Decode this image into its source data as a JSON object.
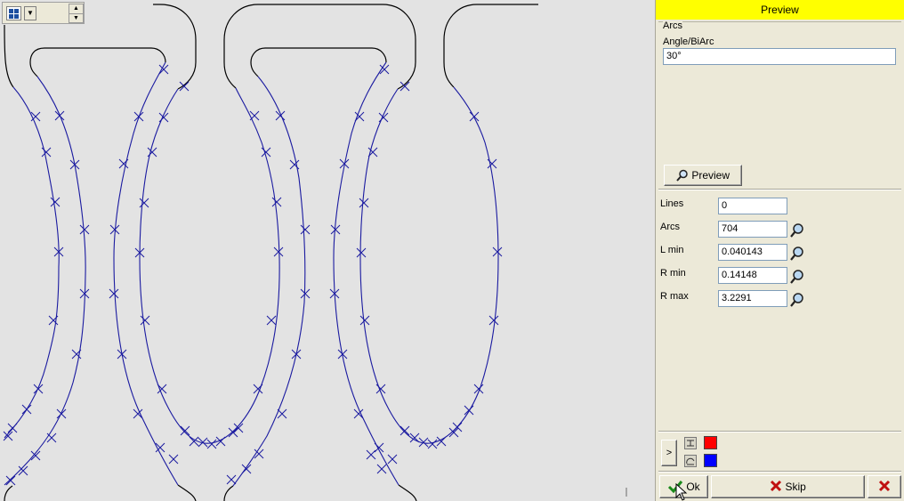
{
  "panel": {
    "header": "Preview",
    "arcs_group": {
      "caption": "Arcs",
      "angle_label": "Angle/BiArc",
      "angle_value": "30°",
      "preview_button": "Preview"
    },
    "stats": [
      {
        "label": "Lines",
        "value": "0"
      },
      {
        "label": "Arcs",
        "value": "704"
      },
      {
        "label": "L min",
        "value": "0.040143"
      },
      {
        "label": "R min",
        "value": "0.14148"
      },
      {
        "label": "R max",
        "value": "3.2291"
      }
    ],
    "colors": {
      "red": "#ff0000",
      "blue": "#0000ff",
      "header": "#ffff00",
      "curve": "#1a1aa0"
    },
    "buttons": {
      "ok": "Ok",
      "skip": "Skip",
      "expand": ">"
    }
  },
  "icons": [
    "grid-view-icon",
    "chevron-down-icon",
    "spin-up-icon",
    "spin-down-icon",
    "magnifier-icon",
    "checkmark-icon",
    "red-x-icon",
    "line-tool-icon",
    "arc-tool-icon"
  ]
}
